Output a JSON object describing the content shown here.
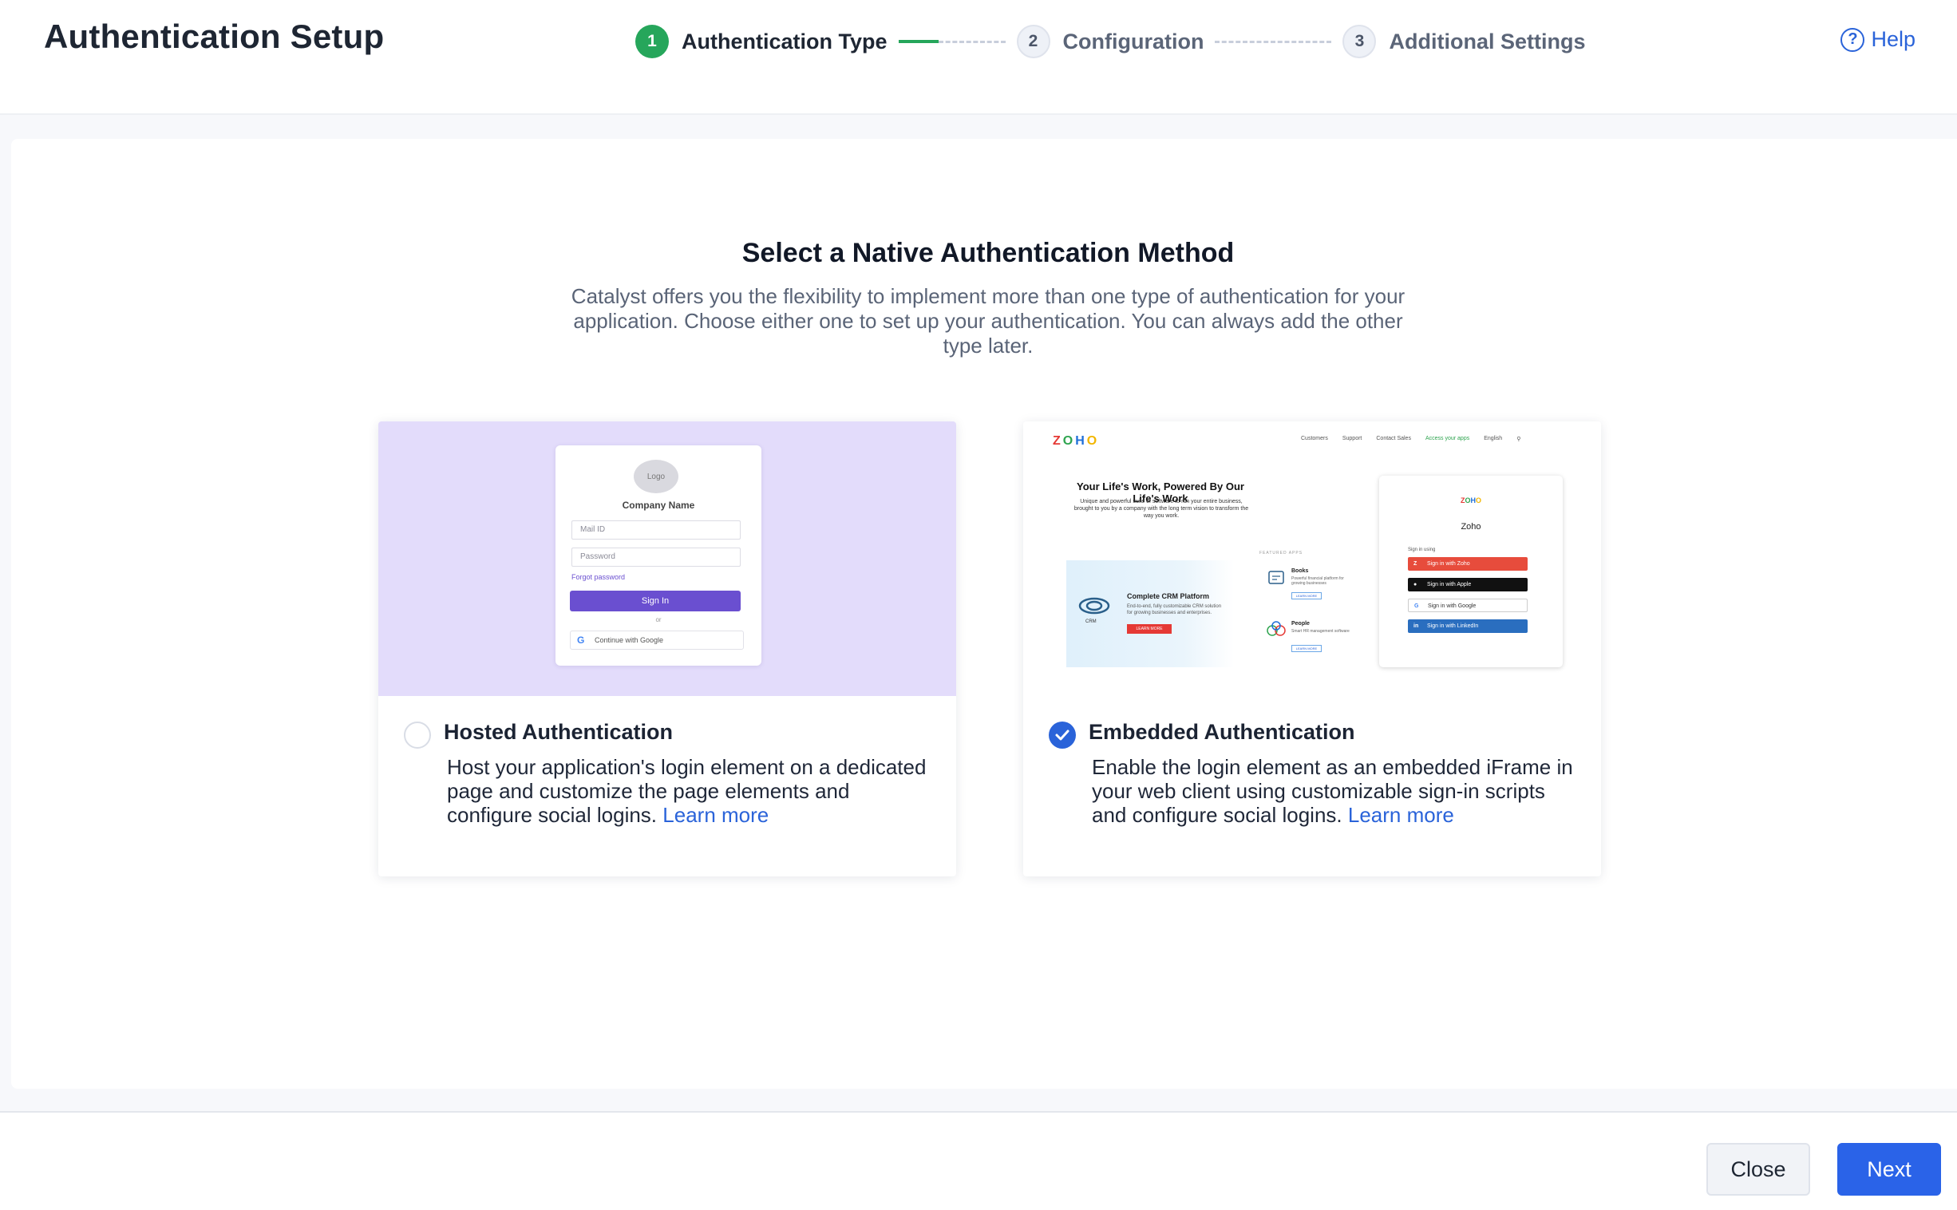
{
  "header": {
    "title": "Authentication Setup",
    "help_label": "Help",
    "steps": [
      {
        "number": "1",
        "label": "Authentication Type",
        "state": "active"
      },
      {
        "number": "2",
        "label": "Configuration",
        "state": "idle"
      },
      {
        "number": "3",
        "label": "Additional Settings",
        "state": "idle"
      }
    ]
  },
  "main": {
    "title": "Select a Native Authentication Method",
    "description": "Catalyst offers you the flexibility to implement more than one type of authentication for your application. Choose either one to set up your authentication. You can always add the other type later.",
    "cards": [
      {
        "title": "Hosted Authentication",
        "description": "Host your application's login element on a dedicated page and customize the page elements and configure social logins.",
        "link": "Learn more",
        "selected": false
      },
      {
        "title": "Embedded Authentication",
        "description": "Enable the login element as an embedded iFrame in your web client using customizable sign-in scripts and configure social logins.",
        "link": "Learn more",
        "selected": true
      }
    ]
  },
  "hosted_preview": {
    "logo": "Logo",
    "company": "Company Name",
    "mail_placeholder": "Mail ID",
    "password_placeholder": "Password",
    "forgot": "Forgot password",
    "signin": "Sign In",
    "or": "or",
    "google": "Continue with Google"
  },
  "embedded_preview": {
    "nav": [
      "Customers",
      "Support",
      "Contact Sales",
      "Access your apps",
      "English"
    ],
    "headline": "Your Life's Work, Powered By Our Life's Work",
    "subhead": "Unique and powerful suite of software to run your entire business, brought to you by a company with the long term vision to transform the way you work.",
    "featured": "FEATURED APPS",
    "crm_title": "Complete CRM Platform",
    "crm_desc": "End-to-end, fully customizable CRM solution for growing businesses and enterprises.",
    "crm_btn": "LEARN MORE",
    "crm_label": "CRM",
    "books": "Books",
    "books_desc": "Powerful financial platform for growing businesses",
    "people": "People",
    "people_desc": "Smart HR management software",
    "app_btn": "LEARN MORE",
    "signin_name": "Zoho",
    "signin_using": "Sign in using",
    "btn_zoho": "Sign in with Zoho",
    "btn_apple": "Sign in with Apple",
    "btn_google": "Sign in with Google",
    "btn_linkedin": "Sign in with LinkedIn"
  },
  "footer": {
    "close_label": "Close",
    "next_label": "Next"
  },
  "colors": {
    "accent": "#2a63e8",
    "step_active": "#26a65b",
    "hosted_bg": "#e3dcfb"
  }
}
